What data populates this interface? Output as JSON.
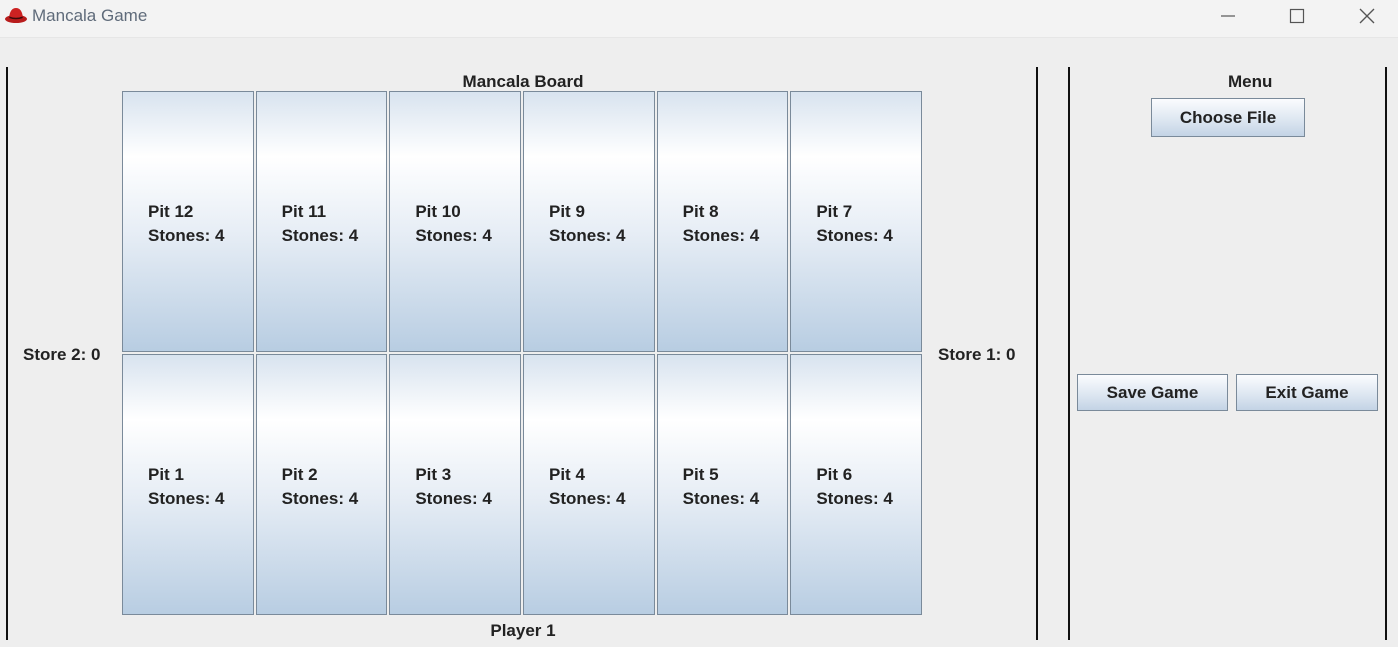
{
  "window": {
    "title": "Mancala Game",
    "minimize_icon": "minimize-icon",
    "maximize_icon": "maximize-icon",
    "close_icon": "close-icon"
  },
  "board": {
    "title": "Mancala Board",
    "player_label": "Player 1",
    "store_left": "Store 2: 0",
    "store_right": "Store 1: 0",
    "top_row": [
      {
        "name": "Pit 12",
        "stones": "Stones: 4"
      },
      {
        "name": "Pit 11",
        "stones": "Stones: 4"
      },
      {
        "name": "Pit 10",
        "stones": "Stones: 4"
      },
      {
        "name": "Pit 9",
        "stones": "Stones: 4"
      },
      {
        "name": "Pit 8",
        "stones": "Stones: 4"
      },
      {
        "name": "Pit 7",
        "stones": "Stones: 4"
      }
    ],
    "bottom_row": [
      {
        "name": "Pit 1",
        "stones": "Stones: 4"
      },
      {
        "name": "Pit 2",
        "stones": "Stones: 4"
      },
      {
        "name": "Pit 3",
        "stones": "Stones: 4"
      },
      {
        "name": "Pit 4",
        "stones": "Stones: 4"
      },
      {
        "name": "Pit 5",
        "stones": "Stones: 4"
      },
      {
        "name": "Pit 6",
        "stones": "Stones: 4"
      }
    ]
  },
  "menu": {
    "title": "Menu",
    "choose_file": "Choose File",
    "save_game": "Save Game",
    "exit_game": "Exit Game"
  },
  "colors": {
    "background": "#eeeeee",
    "pit_border": "#7a8a9a",
    "pit_gradient_bottom": "#b8cde2",
    "text": "#222222"
  }
}
